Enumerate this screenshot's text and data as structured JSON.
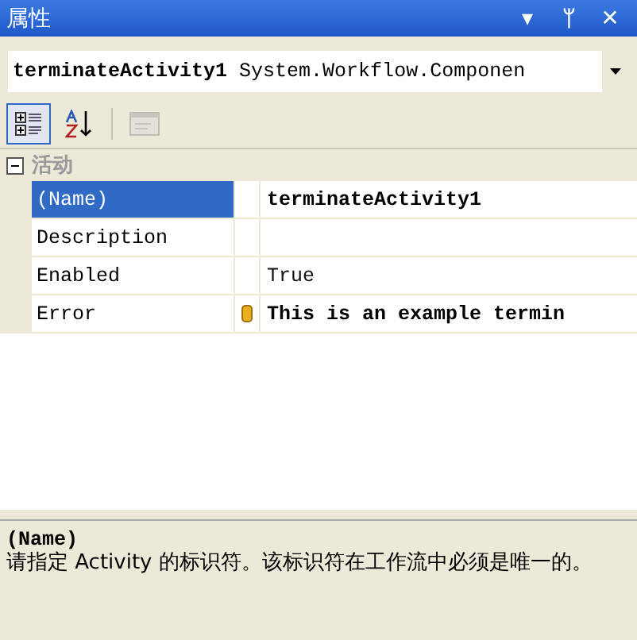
{
  "window": {
    "title": "属性",
    "buttons": [
      "▾",
      "ᛘ",
      "✕"
    ]
  },
  "object_selector": {
    "value": "terminateActivity1",
    "type": "System.Workflow.Componen"
  },
  "toolbar": [
    {
      "kind": "categorized",
      "selected": true,
      "disabled": false
    },
    {
      "kind": "alphabetical",
      "selected": false,
      "disabled": false
    },
    {
      "kind": "property-pages",
      "selected": false,
      "disabled": true
    }
  ],
  "category": {
    "label": "活动",
    "expanded": true
  },
  "properties": [
    {
      "name": "(Name)",
      "value": "terminateActivity1",
      "selected": true,
      "bold": true,
      "warning": false
    },
    {
      "name": "Description",
      "selected": false,
      "warning": false
    },
    {
      "name": "Enabled",
      "value": "True",
      "selected": false,
      "bold": false,
      "warning": false
    },
    {
      "name": "Error",
      "value": "This is an example termin",
      "selected": false,
      "bold": true,
      "warning": true
    }
  ],
  "description": {
    "title": "(Name)",
    "text": "请指定 Activity 的标识符。该标识符在工作流中必须是唯一的。"
  }
}
